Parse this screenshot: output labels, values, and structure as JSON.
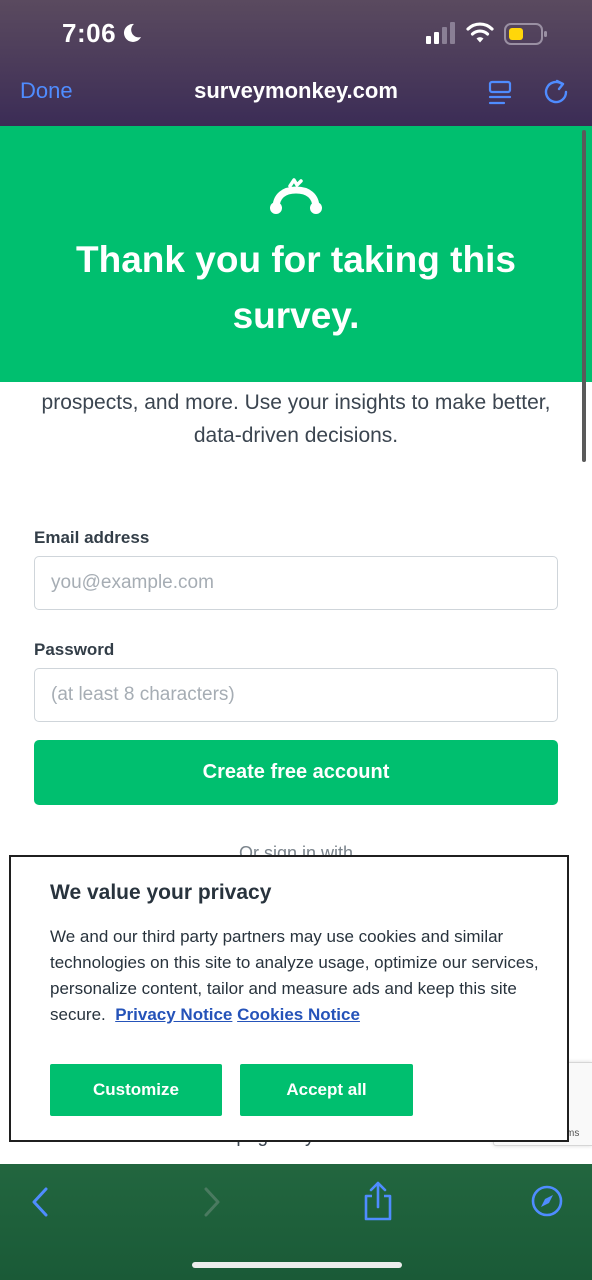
{
  "status_bar": {
    "time": "7:06"
  },
  "browser": {
    "done_label": "Done",
    "url": "surveymonkey.com"
  },
  "hero": {
    "title": "Thank you for taking this survey."
  },
  "intro": {
    "text": "prospects, and more. Use your insights to make better, data-driven decisions."
  },
  "form": {
    "email_label": "Email address",
    "email_placeholder": "you@example.com",
    "email_value": "",
    "password_label": "Password",
    "password_placeholder": "(at least 8 characters)",
    "password_value": "",
    "create_button": "Create free account",
    "or_sign_in": "Or sign in with"
  },
  "privacy": {
    "title": "We value your privacy",
    "body": "We and our third party partners may use cookies and similar technologies on this site to analyze usage, optimize our services, personalize content, tailor and measure ads and keep this site secure.",
    "privacy_link": "Privacy Notice",
    "cookies_link": "Cookies Notice",
    "customize_button": "Customize",
    "accept_button": "Accept all"
  },
  "page_bottom_text": "page anytime.",
  "recaptcha_text": "ms",
  "colors": {
    "brand_green": "#00bf6f",
    "link_blue": "#2553b9",
    "browser_accent": "#4f8cff"
  },
  "icons": [
    "moon-icon",
    "signal-icon",
    "wifi-icon",
    "battery-icon",
    "reader-icon",
    "reload-icon",
    "surveymonkey-logo-icon",
    "back-icon",
    "forward-icon",
    "share-icon",
    "compass-icon"
  ]
}
